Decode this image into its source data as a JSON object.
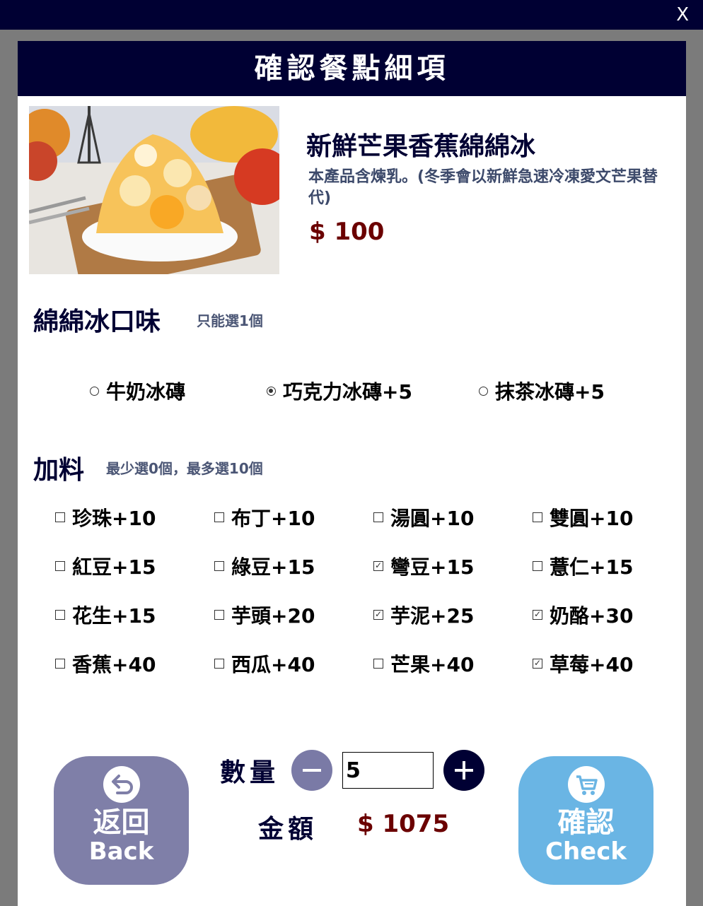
{
  "window": {
    "close_label": "X"
  },
  "dialog": {
    "title": "確認餐點細項"
  },
  "product": {
    "name": "新鮮芒果香蕉綿綿冰",
    "description": "本產品含煉乳。(冬季會以新鮮急速冷凍愛文芒果替代)",
    "price": "$ 100"
  },
  "flavor": {
    "title": "綿綿冰口味",
    "note": "只能選1個",
    "options": [
      {
        "label": "牛奶冰磚",
        "selected": false
      },
      {
        "label": "巧克力冰磚+5",
        "selected": true
      },
      {
        "label": "抹茶冰磚+5",
        "selected": false
      }
    ]
  },
  "toppings": {
    "title": "加料",
    "note": "最少選0個，最多選10個",
    "items": [
      {
        "label": "珍珠+10",
        "checked": false
      },
      {
        "label": "布丁+10",
        "checked": false
      },
      {
        "label": "湯圓+10",
        "checked": false
      },
      {
        "label": "雙圓+10",
        "checked": false
      },
      {
        "label": "紅豆+15",
        "checked": false
      },
      {
        "label": "綠豆+15",
        "checked": false
      },
      {
        "label": "彎豆+15",
        "checked": true
      },
      {
        "label": "薏仁+15",
        "checked": false
      },
      {
        "label": "花生+15",
        "checked": false
      },
      {
        "label": "芋頭+20",
        "checked": false
      },
      {
        "label": "芋泥+25",
        "checked": true
      },
      {
        "label": "奶酪+30",
        "checked": true
      },
      {
        "label": "香蕉+40",
        "checked": false
      },
      {
        "label": "西瓜+40",
        "checked": false
      },
      {
        "label": "芒果+40",
        "checked": false
      },
      {
        "label": "草莓+40",
        "checked": true
      }
    ]
  },
  "quantity": {
    "label": "數量",
    "value": "5"
  },
  "amount": {
    "label": "金額",
    "value": "$ 1075"
  },
  "buttons": {
    "back": {
      "zh": "返回",
      "en": "Back"
    },
    "check": {
      "zh": "確認",
      "en": "Check"
    }
  },
  "colors": {
    "navy": "#000033",
    "price_red": "#6b0000",
    "back_purple": "#7f7fa8",
    "check_blue": "#6ab5e4"
  },
  "icons": {
    "back": "undo-arrow-icon",
    "check": "shopping-cart-icon",
    "minus": "minus-icon",
    "plus": "plus-icon"
  }
}
